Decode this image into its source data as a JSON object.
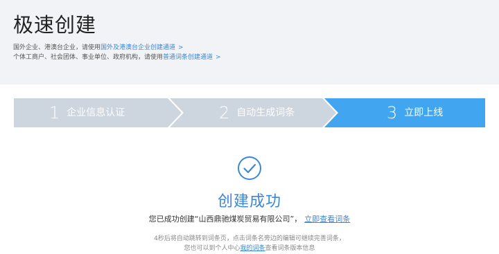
{
  "header": {
    "title": "极速创建",
    "hint1_prefix": "国外企业、港澳台企业，请使用",
    "hint1_link": "国外及港澳台企业创建通道",
    "hint2_prefix": "个体工商户、社会团体、事业单位、政府机构，请使用",
    "hint2_link": "普通词条创建通道",
    "link_arrow": ">"
  },
  "steps": [
    {
      "num": "1",
      "label": "企业信息认证",
      "state": "done"
    },
    {
      "num": "2",
      "label": "自动生成词条",
      "state": "done"
    },
    {
      "num": "3",
      "label": "立即上线",
      "state": "active"
    }
  ],
  "colors": {
    "step_inactive": "#cdd5df",
    "step_active": "#42a5ef",
    "accent": "#3a87d6"
  },
  "result": {
    "icon": "check-circle-icon",
    "title": "创建成功",
    "message": "您已成功创建“山西鼎驰煤炭贸易有限公司”，",
    "view_link": "立即查看词条",
    "note1": "4秒后将自动跳转到词条页，点击词条名旁边的编辑可继续完善词条，",
    "note2_prefix": "您也可以到个人中心",
    "note2_link": "我的词条",
    "note2_suffix": "查看词条版本信息"
  }
}
